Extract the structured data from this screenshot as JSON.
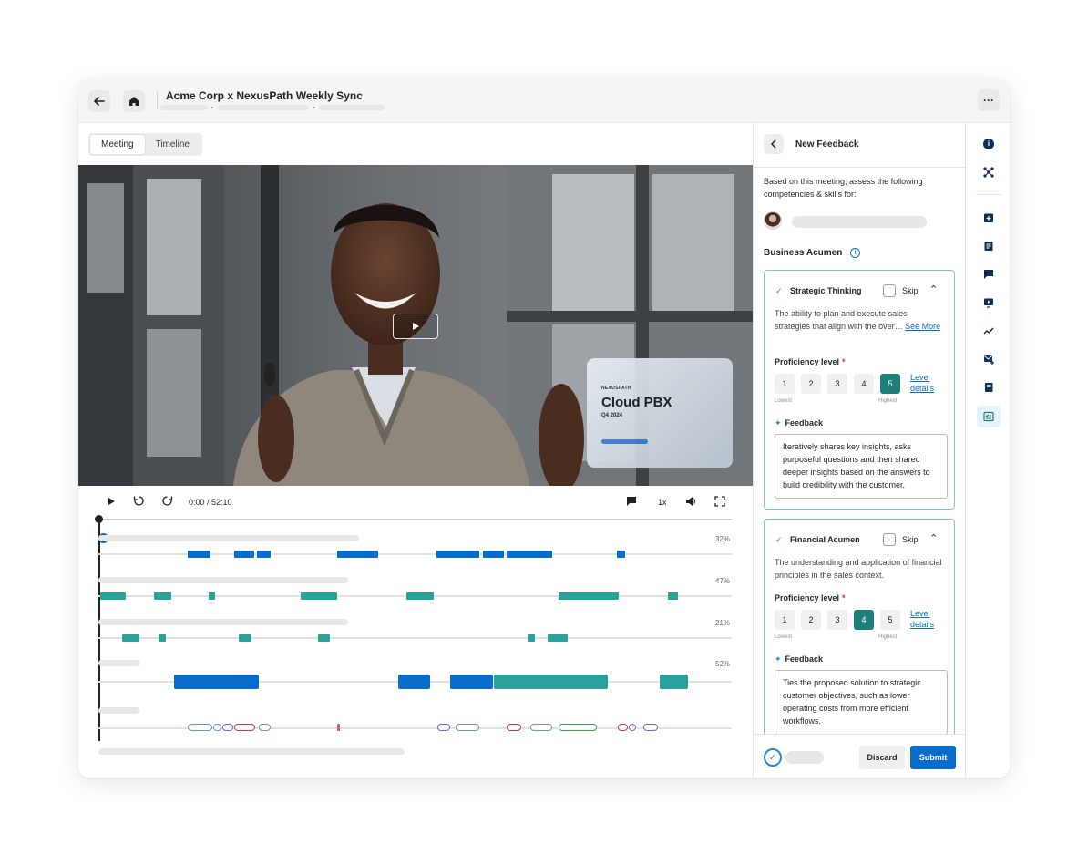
{
  "header": {
    "title": "Acme Corp x NexusPath Weekly Sync",
    "back_icon": "arrow-left-icon",
    "home_icon": "home-icon",
    "more_icon": "ellipsis-icon"
  },
  "tabs": [
    {
      "label": "Meeting",
      "active": true
    },
    {
      "label": "Timeline",
      "active": false
    }
  ],
  "video": {
    "slide": {
      "brand": "NEXUSPATH",
      "title": "Cloud PBX",
      "subtitle": "Q4 2024"
    }
  },
  "player": {
    "time": "0:00 / 52:10",
    "speed": "1x"
  },
  "timeline": {
    "tracks": [
      {
        "percent": "32%"
      },
      {
        "percent": "47%"
      },
      {
        "percent": "21%"
      },
      {
        "percent": "52%"
      }
    ]
  },
  "panel": {
    "title": "New Feedback",
    "intro": "Based on this meeting, assess the following competencies & skills for:",
    "section": "Business Acumen",
    "cards": [
      {
        "title": "Strategic Thinking",
        "skip": "Skip",
        "description": "The ability to plan and execute sales strategies that align with the over…",
        "see_more": "See More",
        "proficiency_label": "Proficiency level",
        "required_mark": "*",
        "levels": [
          "1",
          "2",
          "3",
          "4",
          "5"
        ],
        "selected_level": 5,
        "lowest": "Lowest",
        "highest": "Highest",
        "level_details": "Level details",
        "feedback_label": "Feedback",
        "feedback_text": "Iteratively shares key insights, asks purposeful questions and then shared deeper insights based on the answers to build credibility with the customer."
      },
      {
        "title": "Financial Acumen",
        "skip": "Skip",
        "description": "The understanding and application of financial principles in the sales context.",
        "proficiency_label": "Proficiency level",
        "required_mark": "*",
        "levels": [
          "1",
          "2",
          "3",
          "4",
          "5"
        ],
        "selected_level": 4,
        "lowest": "Lowest",
        "highest": "Highest",
        "level_details": "Level details",
        "feedback_label": "Feedback",
        "feedback_text": "Ties the proposed solution to strategic customer objectives, such as lower operating costs from more efficient workflows."
      }
    ],
    "discard": "Discard",
    "submit": "Submit"
  },
  "colors": {
    "primary": "#0a6ccb",
    "teal": "#2aa19b",
    "selected_level": "#1e7f7a",
    "card_border": "#7cc0e6"
  }
}
